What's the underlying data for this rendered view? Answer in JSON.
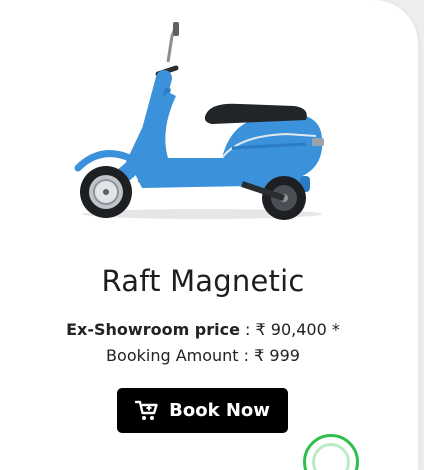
{
  "product": {
    "name": "Raft Magnetic",
    "price_label": "Ex-Showroom price",
    "price_separator": " : ",
    "price_value": "₹ 90,400 *",
    "booking_text": "Booking Amount : ₹ 999",
    "image_icon": "electric-scooter-image"
  },
  "actions": {
    "book_label": "Book Now",
    "book_icon": "cart-icon"
  },
  "floating": {
    "chat_icon": "whatsapp-icon"
  },
  "colors": {
    "scooter_body": "#3b92da",
    "button_bg": "#000000",
    "button_text": "#ffffff",
    "chat_accent": "#2fbf4f"
  }
}
